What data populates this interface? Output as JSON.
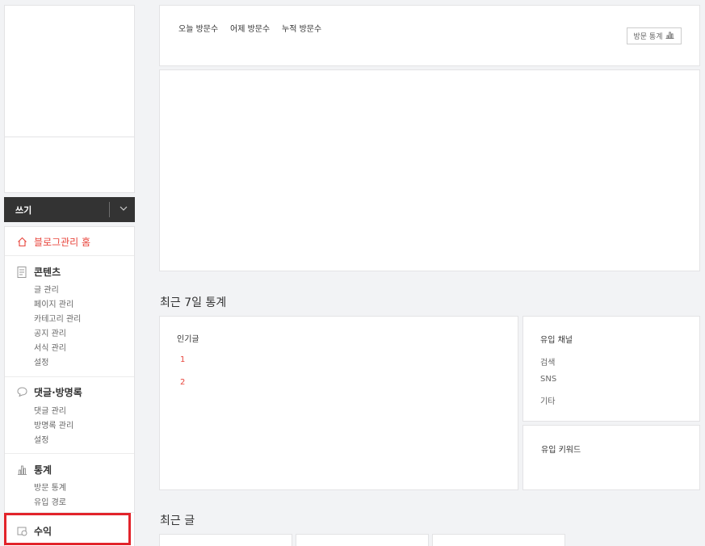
{
  "sidebar": {
    "write_label": "쓰기",
    "home_label": "블로그관리 홈",
    "content": {
      "title": "콘텐츠",
      "items": [
        "글 관리",
        "페이지 관리",
        "카테고리 관리",
        "공지 관리",
        "서식 관리",
        "설정"
      ]
    },
    "comments": {
      "title": "댓글·방명록",
      "items": [
        "댓글 관리",
        "방명록 관리",
        "설정"
      ]
    },
    "stats": {
      "title": "통계",
      "items": [
        "방문 통계",
        "유입 경로"
      ]
    },
    "revenue": {
      "title": "수익"
    }
  },
  "visits": {
    "today_label": "오늘 방문수",
    "yesterday_label": "어제 방문수",
    "total_label": "누적 방문수",
    "stats_button": "방문 통계"
  },
  "recent7": {
    "heading": "최근 7일 통계",
    "popular_title": "인기글",
    "popular_ranks": [
      "1",
      "2"
    ],
    "channel_title": "유입 채널",
    "channels": [
      "검색",
      "SNS",
      "기타"
    ],
    "keyword_title": "유입 키워드"
  },
  "recent_posts": {
    "heading": "최근 글"
  },
  "colors": {
    "accent": "#e8453c",
    "highlight": "#e2242b",
    "dark": "#333333"
  }
}
